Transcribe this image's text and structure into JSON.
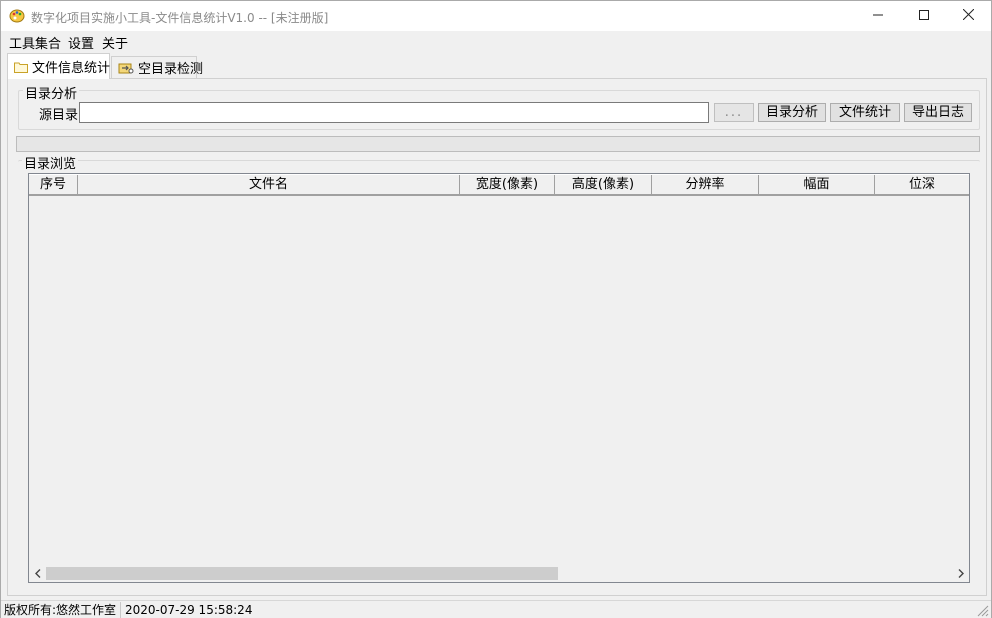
{
  "window": {
    "title": "数字化项目实施小工具-文件信息统计V1.0 -- [未注册版]",
    "controls": [
      "minimize-icon",
      "maximize-icon",
      "close-icon"
    ]
  },
  "menubar": {
    "items": [
      "工具集合",
      "设置",
      "关于"
    ]
  },
  "tabs": [
    {
      "label": "文件信息统计",
      "icon": "folder-icon",
      "active": true
    },
    {
      "label": "空目录检测",
      "icon": "folder-search-icon",
      "active": false
    }
  ],
  "directory_analysis": {
    "group_title": "目录分析",
    "source_label": "源目录",
    "source_value": "",
    "browse_label": "...",
    "buttons": [
      "目录分析",
      "文件统计",
      "导出日志"
    ]
  },
  "progress": {
    "value": 0
  },
  "directory_browse": {
    "group_title": "目录浏览",
    "columns": [
      "序号",
      "文件名",
      "宽度(像素)",
      "高度(像素)",
      "分辨率",
      "幅面",
      "位深"
    ],
    "rows": []
  },
  "statusbar": {
    "copyright": "版权所有:悠然工作室",
    "datetime": "2020-07-29 15:58:24"
  },
  "colors": {
    "title_text": "#8a8a8a",
    "window_bg": "#f0f0f0",
    "progress_fill": "#06b025",
    "icon_yellow": "#f6c844"
  }
}
